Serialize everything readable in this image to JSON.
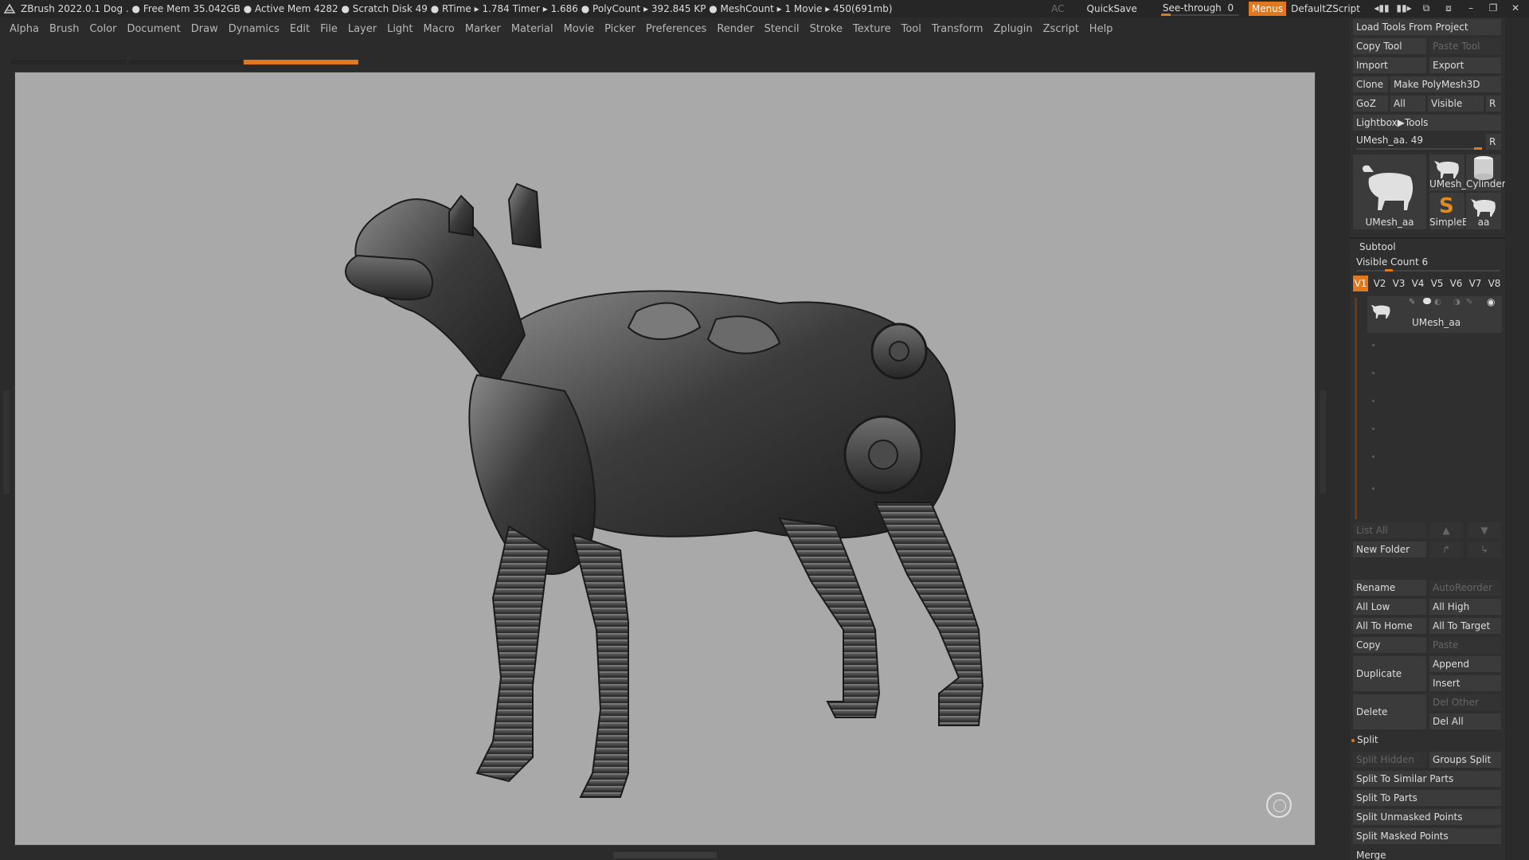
{
  "titlebar": {
    "info": "ZBrush 2022.0.1   Dog   . ● Free Mem 35.042GB ● Active Mem 4282 ● Scratch Disk 49 ●  RTime ▸ 1.784 Timer ▸ 1.686 ● PolyCount ▸ 392.845 KP  ● MeshCount ▸ 1  Movie ▸ 450(691mb)",
    "ac": "AC",
    "quicksave": "QuickSave",
    "see_through_label": "See-through",
    "see_through_value": "0",
    "menus": "Menus",
    "script": "DefaultZScript"
  },
  "menu": [
    "Alpha",
    "Brush",
    "Color",
    "Document",
    "Draw",
    "Dynamics",
    "Edit",
    "File",
    "Layer",
    "Light",
    "Macro",
    "Marker",
    "Material",
    "Movie",
    "Picker",
    "Preferences",
    "Render",
    "Stencil",
    "Stroke",
    "Texture",
    "Tool",
    "Transform",
    "Zplugin",
    "Zscript",
    "Help"
  ],
  "tool": {
    "load_tools": "Load Tools From Project",
    "copy_tool": "Copy Tool",
    "paste_tool": "Paste Tool",
    "import": "Import",
    "export": "Export",
    "clone": "Clone",
    "make_polymesh": "Make PolyMesh3D",
    "goz": "GoZ",
    "all": "All",
    "visible": "Visible",
    "r": "R",
    "lightbox": "Lightbox▶Tools",
    "current_tool": "UMesh_aa. 49",
    "r2": "R",
    "thumbs": [
      "UMesh_aa",
      "UMesh_",
      "Cylinder",
      "SimpleB",
      "aa"
    ]
  },
  "subtool": {
    "title": "Subtool",
    "visible_count_label": "Visible Count",
    "visible_count": "6",
    "vtabs": [
      "V1",
      "V2",
      "V3",
      "V4",
      "V5",
      "V6",
      "V7",
      "V8"
    ],
    "item_name": "UMesh_aa",
    "list_all": "List All",
    "new_folder": "New Folder",
    "rename": "Rename",
    "autoreorder": "AutoReorder",
    "all_low": "All Low",
    "all_high": "All High",
    "all_to_home": "All To Home",
    "all_to_target": "All To Target",
    "copy": "Copy",
    "paste": "Paste",
    "duplicate": "Duplicate",
    "append": "Append",
    "insert": "Insert",
    "delete": "Delete",
    "del_other": "Del Other",
    "del_all": "Del All"
  },
  "split": {
    "title": "Split",
    "split_hidden": "Split Hidden",
    "groups_split": "Groups Split",
    "similar": "Split To Similar Parts",
    "parts": "Split To Parts",
    "unmasked": "Split Unmasked Points",
    "masked": "Split Masked Points"
  },
  "merge": {
    "title": "Merge"
  },
  "colors": {
    "accent": "#e07820",
    "viewport_bg": "#a9a9a9",
    "panel_bg": "#2f2f2f"
  }
}
